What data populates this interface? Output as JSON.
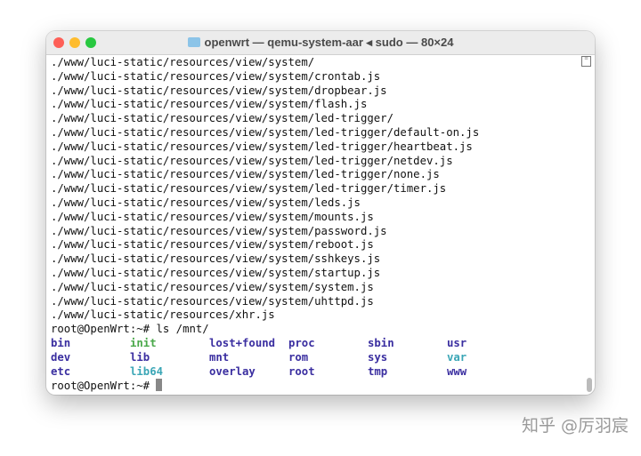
{
  "window": {
    "title": "openwrt — qemu-system-aar ◂ sudo — 80×24"
  },
  "output_lines": [
    "./www/luci-static/resources/view/system/",
    "./www/luci-static/resources/view/system/crontab.js",
    "./www/luci-static/resources/view/system/dropbear.js",
    "./www/luci-static/resources/view/system/flash.js",
    "./www/luci-static/resources/view/system/led-trigger/",
    "./www/luci-static/resources/view/system/led-trigger/default-on.js",
    "./www/luci-static/resources/view/system/led-trigger/heartbeat.js",
    "./www/luci-static/resources/view/system/led-trigger/netdev.js",
    "./www/luci-static/resources/view/system/led-trigger/none.js",
    "./www/luci-static/resources/view/system/led-trigger/timer.js",
    "./www/luci-static/resources/view/system/leds.js",
    "./www/luci-static/resources/view/system/mounts.js",
    "./www/luci-static/resources/view/system/password.js",
    "./www/luci-static/resources/view/system/reboot.js",
    "./www/luci-static/resources/view/system/sshkeys.js",
    "./www/luci-static/resources/view/system/startup.js",
    "./www/luci-static/resources/view/system/system.js",
    "./www/luci-static/resources/view/system/uhttpd.js",
    "./www/luci-static/resources/xhr.js"
  ],
  "command_line": "root@OpenWrt:~# ls /mnt/",
  "ls_entries": [
    {
      "name": "bin",
      "type": "d"
    },
    {
      "name": "init",
      "type": "x"
    },
    {
      "name": "lost+found",
      "type": "d"
    },
    {
      "name": "proc",
      "type": "d"
    },
    {
      "name": "sbin",
      "type": "d"
    },
    {
      "name": "usr",
      "type": "d"
    },
    {
      "name": "dev",
      "type": "d"
    },
    {
      "name": "lib",
      "type": "d"
    },
    {
      "name": "mnt",
      "type": "d"
    },
    {
      "name": "rom",
      "type": "d"
    },
    {
      "name": "sys",
      "type": "d"
    },
    {
      "name": "var",
      "type": "l"
    },
    {
      "name": "etc",
      "type": "d"
    },
    {
      "name": "lib64",
      "type": "l"
    },
    {
      "name": "overlay",
      "type": "d"
    },
    {
      "name": "root",
      "type": "d"
    },
    {
      "name": "tmp",
      "type": "d"
    },
    {
      "name": "www",
      "type": "d"
    }
  ],
  "prompt": "root@OpenWrt:~# ",
  "colors": {
    "dir": "#3a2ea0",
    "exec": "#4aa84a",
    "link": "#3aa6b6"
  },
  "watermark": "知乎 @厉羽宸"
}
